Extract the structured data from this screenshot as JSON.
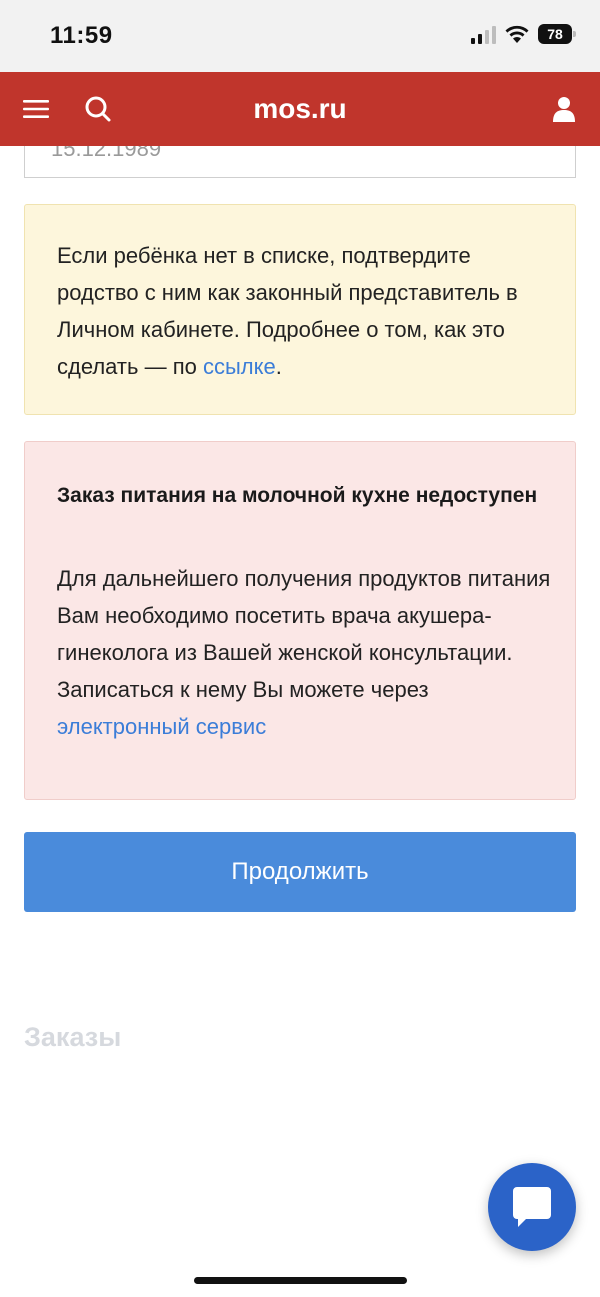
{
  "status_bar": {
    "time": "11:59",
    "battery": "78"
  },
  "header": {
    "title": "mos.ru"
  },
  "form": {
    "birthdate_value": "15.12.1989"
  },
  "info_notice": {
    "text_before_link": "Если ребёнка нет в списке, подтвердите родство с ним как законный представитель в Личном кабинете. Подробнее о том, как это сделать — по ",
    "link_text": "ссылке",
    "text_after_link": "."
  },
  "warning_notice": {
    "title": "Заказ питания на молочной кухне недоступен",
    "text_before_link": "Для дальнейшего получения продуктов питания Вам необходимо посетить врача акушера-гинеколога из Вашей женской консультации. Записаться к нему Вы можете через ",
    "link_text": "электронный сервис"
  },
  "continue_button": {
    "label": "Продолжить"
  },
  "orders_section": {
    "title": "Заказы"
  },
  "colors": {
    "header_red": "#c0352c",
    "info_bg": "#fdf6dc",
    "warning_bg": "#fbe7e6",
    "primary_button": "#4a8bdb",
    "link": "#3b7dd8",
    "fab": "#2b63c8"
  },
  "icons": [
    "menu-icon",
    "search-icon",
    "user-icon",
    "chat-icon",
    "wifi-icon",
    "cellular-signal-icon",
    "battery-icon"
  ]
}
